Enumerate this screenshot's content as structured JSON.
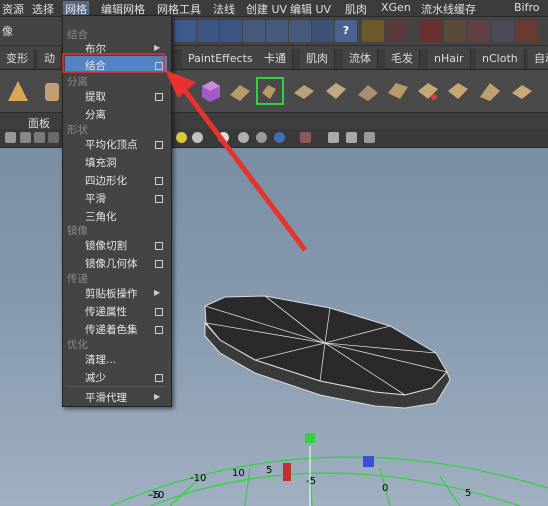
{
  "menubar": {
    "items": [
      "资源",
      "选择",
      "网格",
      "编辑网格",
      "网格工具",
      "法线",
      "创建 UV",
      "编辑 UV",
      "肌肉",
      "XGen",
      "流水线缓存",
      "Bifro"
    ]
  },
  "row1": {
    "left_label": "像"
  },
  "tabs": [
    "变形",
    "动",
    "PaintEffects",
    "卡通",
    "肌肉",
    "流体",
    "毛发",
    "nHair",
    "nCloth",
    "自动"
  ],
  "panel_menu": {
    "label": "面板"
  },
  "dropdown": {
    "sections": {
      "combine": "结合",
      "separate": "分离",
      "shape": "形状",
      "mirror": "镜像",
      "transfer": "传递",
      "optimize": "优化"
    },
    "items": {
      "boolean": "布尔",
      "combine": "结合",
      "extract": "提取",
      "separate": "分离",
      "average_vertices": "平均化顶点",
      "fill_hole": "填充洞",
      "quadrangulate": "四边形化",
      "smooth": "平滑",
      "triangulate": "三角化",
      "mirror_cut": "镜像切割",
      "mirror_geometry": "镜像几何体",
      "clipboard_actions": "剪贴板操作",
      "transfer_attributes": "传递属性",
      "transfer_shading_sets": "传递着色集",
      "cleanup": "清理...",
      "reduce": "减少",
      "smooth_proxy": "平滑代理"
    }
  },
  "grid_labels": [
    "-10",
    "-5",
    "10",
    "5",
    "-5",
    "0",
    "5"
  ],
  "colors": {
    "highlight": "#5283c4",
    "arrow": "#e8322d",
    "grid": "#2fd33a"
  }
}
